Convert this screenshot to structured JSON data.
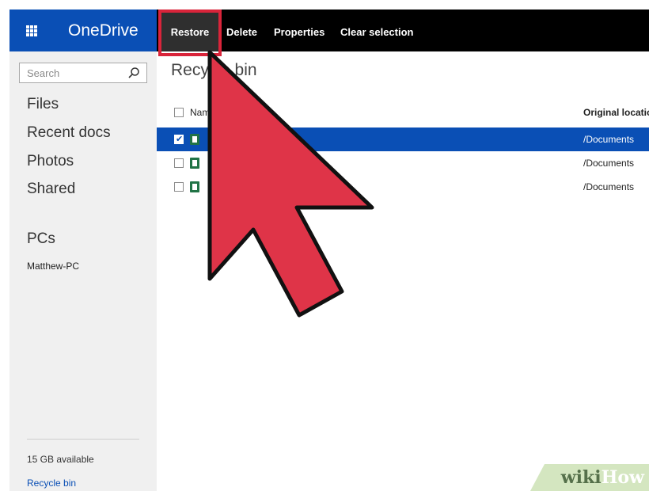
{
  "app": {
    "name": "OneDrive"
  },
  "toolbar": {
    "restore_label": "Restore",
    "delete_label": "Delete",
    "properties_label": "Properties",
    "clear_selection_label": "Clear selection"
  },
  "sidebar": {
    "search_placeholder": "Search",
    "items": [
      {
        "label": "Files"
      },
      {
        "label": "Recent docs"
      },
      {
        "label": "Photos"
      },
      {
        "label": "Shared"
      }
    ],
    "pcs_label": "PCs",
    "pc_name": "Matthew-PC",
    "storage": "15 GB available",
    "recycle_bin_link": "Recycle bin"
  },
  "main": {
    "heading": "Recycle bin",
    "columns": {
      "name": "Name",
      "original_location": "Original location"
    },
    "rows": [
      {
        "location": "/Documents",
        "selected": true
      },
      {
        "location": "/Documents",
        "selected": false
      },
      {
        "location": "/Documents",
        "selected": false
      }
    ]
  },
  "watermark": {
    "wiki": "wiki",
    "how": "How"
  },
  "colors": {
    "brand_blue": "#0a4fb5",
    "toolbar_black": "#000000",
    "annotation_red": "#d9243a",
    "excel_green": "#217346"
  },
  "icons": [
    "app-launcher-icon",
    "search-icon",
    "excel-file-icon",
    "red-arrow-pointer-icon"
  ]
}
